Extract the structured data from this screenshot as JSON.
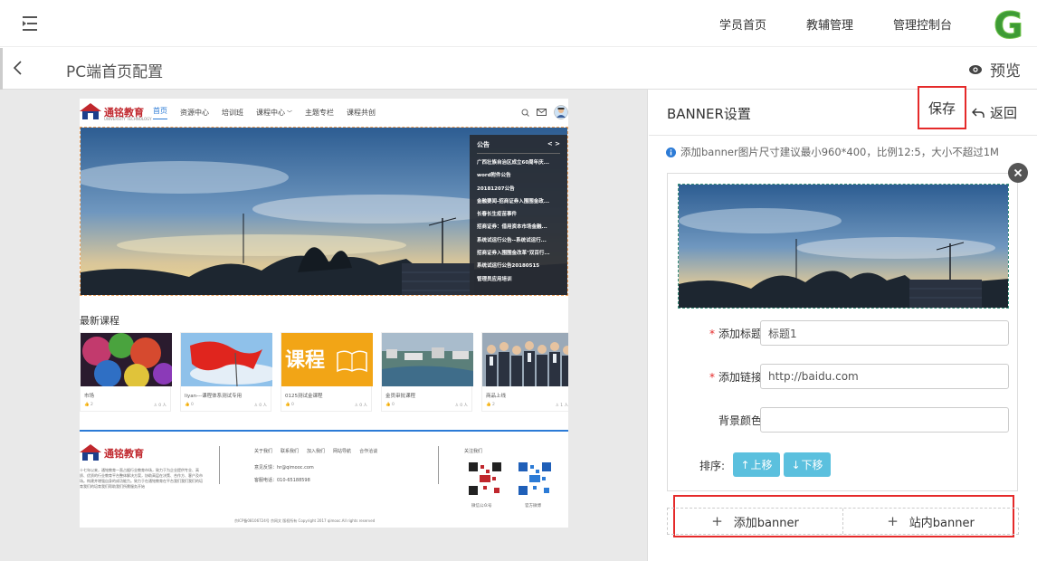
{
  "topnav": {
    "items": [
      "学员首页",
      "教辅管理",
      "管理控制台"
    ],
    "logo_letter": "G"
  },
  "subheader": {
    "title": "PC端首页配置",
    "preview_label": "预览"
  },
  "site": {
    "logo_text": "通铭教育",
    "logo_sub": "UNIVERSITY TECHNOLOGY",
    "menu": [
      "首页",
      "资源中心",
      "培训班",
      "课程中心",
      "主题专栏",
      "课程共创"
    ],
    "notice": {
      "title": "公告",
      "arrows": "< >",
      "items": [
        "广西壮族自治区成立60周年庆...",
        "word附件公告",
        "20181207公告",
        "金融要闻-招商证券入围围金政...",
        "长春长生疫苗事件",
        "招商证券：借用资本市场金融...",
        "系统试运行公告--系统试运行...",
        "招商证券入围围金改革\"双百行...",
        "系统试运行公告20180515",
        "管理员应用培训"
      ]
    },
    "section_title": "最新课程",
    "courses": [
      {
        "name": "市场",
        "likes": "2",
        "people": "0 人"
      },
      {
        "name": "liyan---课程体系测试专用",
        "likes": "0",
        "people": "0 人"
      },
      {
        "name": "0125测试金课程",
        "likes": "0",
        "people": "0 人"
      },
      {
        "name": "金员审批课程",
        "likes": "0",
        "people": "0 人"
      },
      {
        "name": "商品上线",
        "likes": "2",
        "people": "1 人"
      }
    ],
    "course_thumb_text": "课程",
    "footer": {
      "logo_text": "通铭教育",
      "desc": "十七年以来，通铭教育一直占据行业教育市场，致力于为企业提供专业、高质、优质的行业教育平台整体解决方案，协助高层在决策、合作方、客户及市场。构建并增强自身的成功能力。致力于在通铭教育在平台我们我们我们的培育我们的培育我们帮助我们所需服务开始",
      "links": [
        "关于我们",
        "联系我们",
        "加入我们",
        "网站导航",
        "合作洽谈"
      ],
      "feedback": "意见反馈：hr@qimooc.com",
      "phone": "客服电话：010-65188598",
      "follow": "关注我们",
      "qr1_label": "微信公众号",
      "qr2_label": "官方微博",
      "copyright": "京ICP备08106724号 京网文 版权所有 Copyright 2017 qimooc.All rights reserved"
    }
  },
  "panel": {
    "title": "BANNER设置",
    "save_label": "保存",
    "return_label": "返回",
    "tip": "添加banner图片尺寸建议最小960*400，比例12:5，大小不超过1M",
    "form": {
      "title_label": "添加标题:",
      "title_value": "标题1",
      "link_label": "添加链接:",
      "link_value": "http://baidu.com",
      "bg_label": "背景颜色:",
      "bg_value": ""
    },
    "sort_label": "排序:",
    "up_label": "上移",
    "down_label": "下移",
    "add_banner_label": "添加banner",
    "site_banner_label": "站内banner"
  },
  "colors": {
    "accent_blue": "#2c7bd6",
    "highlight_red": "#e52a2a",
    "sort_button": "#5bc0de",
    "logo_green": "#3d9b35"
  }
}
